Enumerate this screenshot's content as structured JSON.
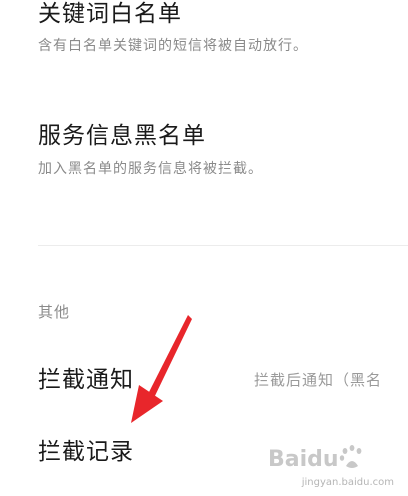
{
  "settings": {
    "keyword_whitelist": {
      "title": "关键词白名单",
      "subtitle": "含有白名单关键词的短信将被自动放行。"
    },
    "service_blacklist": {
      "title": "服务信息黑名单",
      "subtitle": "加入黑名单的服务信息将被拦截。"
    }
  },
  "other_section": {
    "header": "其他",
    "block_notification": {
      "title": "拦截通知",
      "value": "拦截后通知（黑名"
    },
    "block_records": {
      "title": "拦截记录"
    }
  },
  "watermark": {
    "logo_text": "Baidu",
    "caption": "jingyan.baidu.com"
  },
  "colors": {
    "arrow": "#e8262b",
    "title_text": "#1a1a1a",
    "secondary_text": "#8a8a8a"
  }
}
